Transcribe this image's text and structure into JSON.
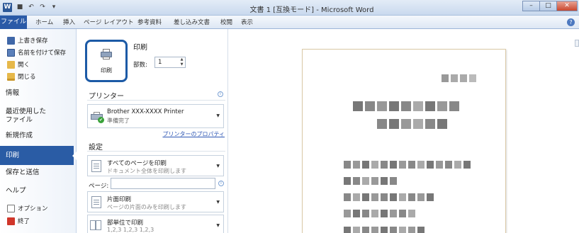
{
  "titlebar": {
    "app_icon": "W",
    "title": "文書 1 [互換モード] - Microsoft Word",
    "qat_icons": [
      "save-icon",
      "undo-icon",
      "redo-icon",
      "customize-icon"
    ],
    "buttons": {
      "minimize": "–",
      "maximize": "□",
      "close": "✕"
    }
  },
  "ribbon": {
    "tabs": [
      "ファイル",
      "ホーム",
      "挿入",
      "ページ レイアウト",
      "参考資料",
      "差し込み文書",
      "校閲",
      "表示"
    ],
    "help": "?"
  },
  "sidebar": {
    "commands_top": [
      {
        "label": "上書き保存",
        "icon": "save-icon"
      },
      {
        "label": "名前を付けて保存",
        "icon": "save-as-icon"
      },
      {
        "label": "開く",
        "icon": "open-folder-icon"
      },
      {
        "label": "閉じる",
        "icon": "close-folder-icon"
      }
    ],
    "sections": [
      "情報",
      "最近使用した\nファイル",
      "新規作成",
      "印刷",
      "保存と送信",
      "ヘルプ"
    ],
    "commands_bottom": [
      {
        "label": "オプション",
        "icon": "options-icon"
      },
      {
        "label": "終了",
        "icon": "exit-icon"
      }
    ]
  },
  "print": {
    "title": "印刷",
    "button_label": "印刷",
    "copies_label": "部数:",
    "copies_value": "1",
    "printer_heading": "プリンター",
    "printer_name": "Brother XXX-XXXX Printer",
    "printer_status": "準備完了",
    "printer_properties_link": "プリンターのプロパティ",
    "settings_heading": "設定",
    "option_all_pages_main": "すべてのページを印刷",
    "option_all_pages_sub": "ドキュメント全体を印刷します",
    "pages_label": "ページ:",
    "pages_value": "",
    "option_one_side_main": "片面印刷",
    "option_one_side_sub": "ページの片面のみを印刷します",
    "option_collate_main": "部単位で印刷",
    "option_collate_sub": "1,2,3   1,2,3   1,2,3",
    "info_icon": "i",
    "dropdown_arrow": "▼"
  },
  "colors": {
    "accent": "#2a5ca5",
    "highlight_ring": "#1c5aa6",
    "link": "#2c55b4"
  }
}
